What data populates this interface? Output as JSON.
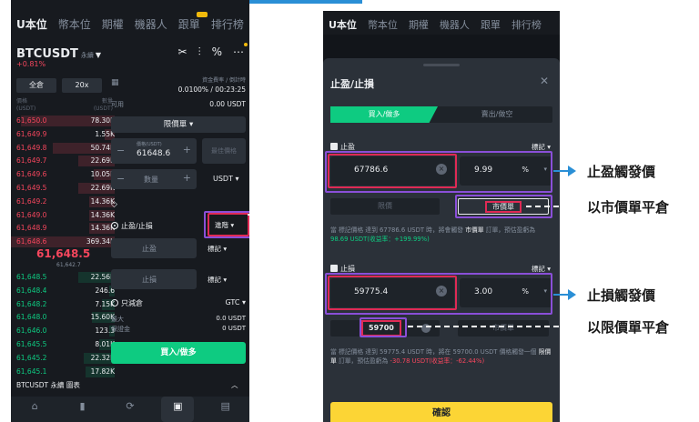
{
  "left_phone": {
    "tabs": [
      "U本位",
      "幣本位",
      "期權",
      "機器人",
      "跟單",
      "排行榜"
    ],
    "pair": "BTCUSDT",
    "pair_tag": "永續",
    "pair_change": "+0.81%",
    "margin_mode": "全倉",
    "leverage": "20x",
    "ob_head_left": "價格\n(USDT)",
    "ob_head_right": "數量\n(USDT)",
    "funding": {
      "label": "資金費率 / 倒計時",
      "value": "0.0100% / 00:23:25"
    },
    "available": {
      "label": "可用",
      "value": "0.00 USDT"
    },
    "order_type": "限價單",
    "price_label": "價格(USDT)",
    "price_value": "61648.6",
    "bbo": "最佳價格",
    "qty_placeholder": "數量",
    "qty_unit": "USDT",
    "tpsl_label": "止盈/止損",
    "tpsl_mode": "進階",
    "tp_placeholder": "止盈",
    "sl_placeholder": "止損",
    "tag": "標記",
    "reduce_only": "只減倉",
    "tif": "GTC",
    "max_label": "最大",
    "max_value": "0.0 USDT",
    "cost_label": "保證金",
    "cost_value": "0 USDT",
    "buy_label": "買入/做多",
    "bottom_label": "BTCUSDT 永續 圖表",
    "nav": [
      "首頁",
      "行情",
      "交易",
      "合約",
      "資產"
    ],
    "asks": [
      {
        "p": "61,650.0",
        "q": "78.30K",
        "f": 0.9
      },
      {
        "p": "61,649.9",
        "q": "1.55K",
        "f": 0.1
      },
      {
        "p": "61,649.8",
        "q": "50.74K",
        "f": 0.6
      },
      {
        "p": "61,649.7",
        "q": "22.69K",
        "f": 0.35
      },
      {
        "p": "61,649.6",
        "q": "10.05K",
        "f": 0.2
      },
      {
        "p": "61,649.5",
        "q": "22.69K",
        "f": 0.35
      },
      {
        "p": "61,649.2",
        "q": "14.36K",
        "f": 0.25
      },
      {
        "p": "61,649.0",
        "q": "14.36K",
        "f": 0.25
      },
      {
        "p": "61,648.9",
        "q": "14.36K",
        "f": 0.25
      },
      {
        "p": "61,648.6",
        "q": "369.34K",
        "f": 1.0
      }
    ],
    "mid_price": "61,648.5",
    "mid_sub": "61,642.7",
    "bids": [
      {
        "p": "61,648.5",
        "q": "22.56K",
        "f": 0.35
      },
      {
        "p": "61,648.4",
        "q": "246.6",
        "f": 0.05
      },
      {
        "p": "61,648.2",
        "q": "7.15K",
        "f": 0.12
      },
      {
        "p": "61,648.0",
        "q": "15.60K",
        "f": 0.22
      },
      {
        "p": "61,646.0",
        "q": "123.3",
        "f": 0.05
      },
      {
        "p": "61,645.5",
        "q": "8.01K",
        "f": 0.15
      },
      {
        "p": "61,645.2",
        "q": "22.32K",
        "f": 0.3
      },
      {
        "p": "61,645.1",
        "q": "17.82K",
        "f": 0.28
      }
    ]
  },
  "right_phone": {
    "tabs": [
      "U本位",
      "幣本位",
      "期權",
      "機器人",
      "跟單",
      "排行榜"
    ],
    "sheet_title": "止盈/止損",
    "close": "✕",
    "buy_tab": "買入/做多",
    "sell_tab": "賣出/做空",
    "tp": {
      "label": "止盈",
      "mark": "標記",
      "price": "67786.6",
      "pct": "9.99",
      "unit": "%",
      "limit_btn": "限價",
      "market_btn": "市價單",
      "desc_a": "當 標記價格 達到 67786.6 USDT 時，將會觸發 ",
      "desc_market": "市價單",
      "desc_b": " 訂單，預估盈虧為 ",
      "desc_pnl": "98.69 USDT(收益率：+199.99%)"
    },
    "sl": {
      "label": "止損",
      "mark": "標記",
      "price": "59775.4",
      "pct": "3.00",
      "unit": "%",
      "limit_price": "59700",
      "market_btn": "市價單",
      "desc_a": "當 標記價格 達到 59775.4 USDT 時，將在 59700.0 USDT 價格觸發一個 ",
      "desc_limit": "限價單",
      "desc_b": " 訂單，預估盈虧為 ",
      "desc_pnl": "-30.78 USDT(收益率：-62.44%)"
    },
    "confirm": "確認"
  },
  "annotations": {
    "tp_trigger": "止盈觸發價",
    "market_close": "以市價單平倉",
    "sl_trigger": "止損觸發價",
    "limit_close": "以限價單平倉"
  },
  "colors": {
    "accent_red": "#e02a55",
    "accent_purple": "#8a4fd8",
    "buy_green": "#0ecb81",
    "sell_red": "#f6465d",
    "confirm_yellow": "#fcd535",
    "annotation_blue": "#2a8fd6"
  }
}
